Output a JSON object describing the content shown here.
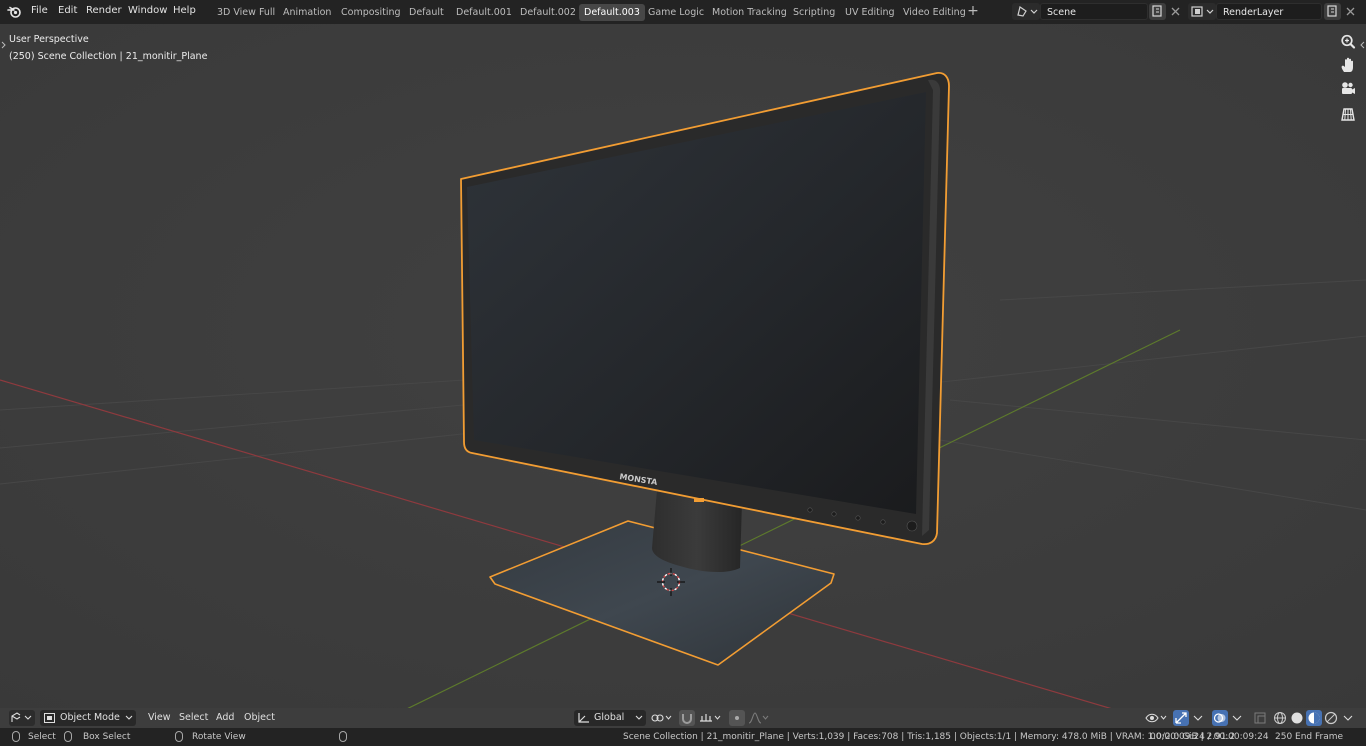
{
  "menus": [
    "File",
    "Edit",
    "Render",
    "Window",
    "Help"
  ],
  "workspaces": [
    "3D View Full",
    "Animation",
    "Compositing",
    "Default",
    "Default.001",
    "Default.002",
    "Default.003",
    "Game Logic",
    "Motion Tracking",
    "Scripting",
    "UV Editing",
    "Video Editing"
  ],
  "active_workspace": "Default.003",
  "scene_field": "Scene",
  "render_layer_field": "RenderLayer",
  "viewport": {
    "perspective_label": "User Perspective",
    "collection_label": "(250) Scene Collection | 21_monitir_Plane",
    "monitor_brand": "MONSTA"
  },
  "header": {
    "mode": "Object Mode",
    "view": "View",
    "select": "Select",
    "add": "Add",
    "object": "Object",
    "transform_orientation": "Global"
  },
  "status": {
    "select": "Select",
    "box_select": "Box Select",
    "rotate_view": "Rotate View",
    "stats": "Scene Collection | 21_monitir_Plane | Verts:1,039 | Faces:708 | Tris:1,185 | Objects:1/1 | Memory: 478.0 MiB | VRAM: 1.0/2.0 GiB | 2.91.2",
    "time": "00:00:09:24 / 00:00:09:24",
    "frame": "250 End Frame"
  },
  "colors": {
    "selection_outline": "#f29d33",
    "x_axis": "#8e3a3e",
    "y_axis": "#5d7a2c",
    "active_blue": "#4772b3"
  },
  "icons": [
    "blender-logo-icon",
    "zoom-icon",
    "hand-pan-icon",
    "camera-icon",
    "grid-ortho-icon",
    "cursor-icon"
  ]
}
